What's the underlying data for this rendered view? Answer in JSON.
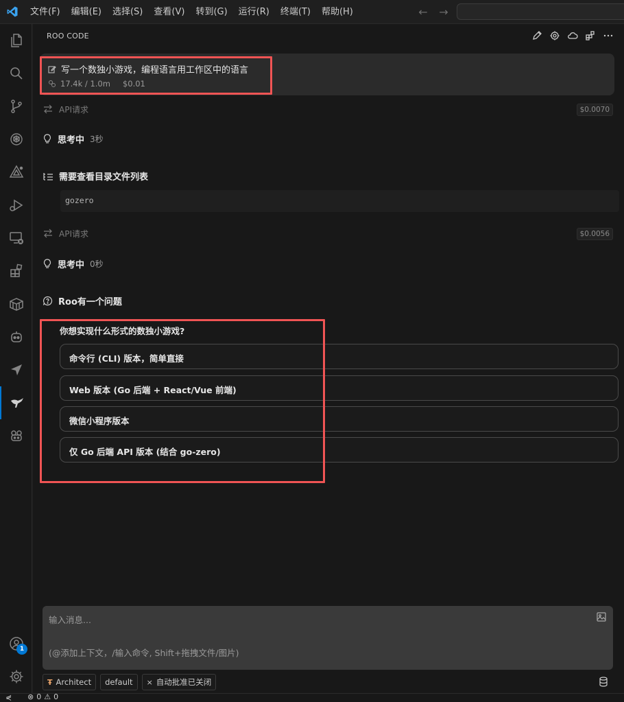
{
  "menu": [
    "文件(F)",
    "编辑(E)",
    "选择(S)",
    "查看(V)",
    "转到(G)",
    "运行(R)",
    "终端(T)",
    "帮助(H)"
  ],
  "panel": {
    "title": "ROO CODE"
  },
  "task": {
    "title": "写一个数独小游戏，编程语言用工作区中的语言",
    "tokens": "17.4k / 1.0m",
    "cost": "$0.01"
  },
  "api1": {
    "label": "API请求",
    "cost": "$0.0070"
  },
  "think1": {
    "label": "思考中",
    "time": "3秒"
  },
  "listdir": {
    "label": "需要查看目录文件列表",
    "path": "gozero"
  },
  "api2": {
    "label": "API请求",
    "cost": "$0.0056"
  },
  "think2": {
    "label": "思考中",
    "time": "0秒"
  },
  "question": {
    "header": "Roo有一个问题",
    "text": "你想实现什么形式的数独小游戏?"
  },
  "options": [
    "命令行 (CLI) 版本，简单直接",
    "Web 版本 (Go 后端 + React/Vue 前端)",
    "微信小程序版本",
    "仅 Go 后端 API 版本 (结合 go-zero)"
  ],
  "composer": {
    "placeholder_line1": "输入消息...",
    "placeholder_line2": "(@添加上下文，/输入命令, Shift+拖拽文件/图片)"
  },
  "chips": {
    "mode": "Architect",
    "config": "default",
    "auto": "自动批准已关闭"
  },
  "accounts_badge": "1",
  "status": {
    "errors": "0",
    "warnings": "0"
  }
}
